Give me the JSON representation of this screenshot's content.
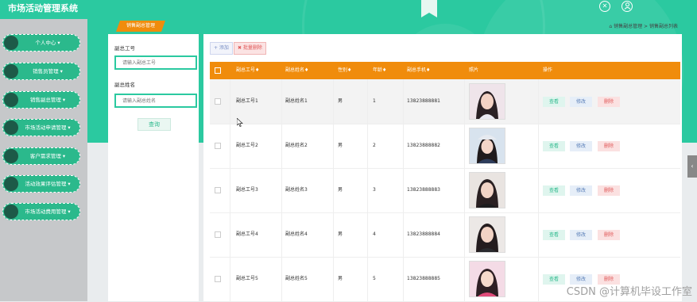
{
  "app": {
    "title": "市场活动管理系统"
  },
  "header_icons": [
    {
      "name": "close-circle-icon",
      "glyph": "✕"
    },
    {
      "name": "user-icon",
      "glyph": "👤"
    }
  ],
  "sidebar": {
    "items": [
      {
        "label": "个人中心 ▾"
      },
      {
        "label": "销售员管理 ▾"
      },
      {
        "label": "销售副总管理 ▾"
      },
      {
        "label": "市场活动申请管理 ▾"
      },
      {
        "label": "客户需求管理 ▾"
      },
      {
        "label": "活动效果评估管理 ▾"
      },
      {
        "label": "市场活动费用管理 ▾"
      }
    ]
  },
  "page_tag": "销售副总管理",
  "breadcrumb": {
    "home_icon": "⌂",
    "items": [
      "销售副总管理",
      ">",
      "销售副总列表"
    ]
  },
  "search": {
    "field1_label": "副总工号",
    "field1_placeholder": "请输入副总工号",
    "field2_label": "副总姓名",
    "field2_placeholder": "请输入副总姓名",
    "button": "查询"
  },
  "toolbar": {
    "add": "+ 添加",
    "batch_delete": "✖ 批量删除"
  },
  "table": {
    "headers": [
      "副总工号♦",
      "副总姓名♦",
      "性别♦",
      "年龄♦",
      "副总手机♦",
      "照片",
      "操作"
    ],
    "rows": [
      {
        "id": "副总工号1",
        "name": "副总姓名1",
        "gender": "男",
        "age": "1",
        "phone": "13823888881"
      },
      {
        "id": "副总工号2",
        "name": "副总姓名2",
        "gender": "男",
        "age": "2",
        "phone": "13823888882"
      },
      {
        "id": "副总工号3",
        "name": "副总姓名3",
        "gender": "男",
        "age": "3",
        "phone": "13823888883"
      },
      {
        "id": "副总工号4",
        "name": "副总姓名4",
        "gender": "男",
        "age": "4",
        "phone": "13823888884"
      },
      {
        "id": "副总工号5",
        "name": "副总姓名5",
        "gender": "男",
        "age": "5",
        "phone": "13823888885"
      }
    ],
    "actions": {
      "view": "查看",
      "edit": "修改",
      "delete": "删除"
    }
  },
  "watermark": "CSDN @计算机毕设工作室",
  "colors": {
    "primary": "#2bc9a0",
    "accent": "#f08c0c",
    "sidebar_bg": "#c6c8ca",
    "dot": "#1d5a48"
  }
}
